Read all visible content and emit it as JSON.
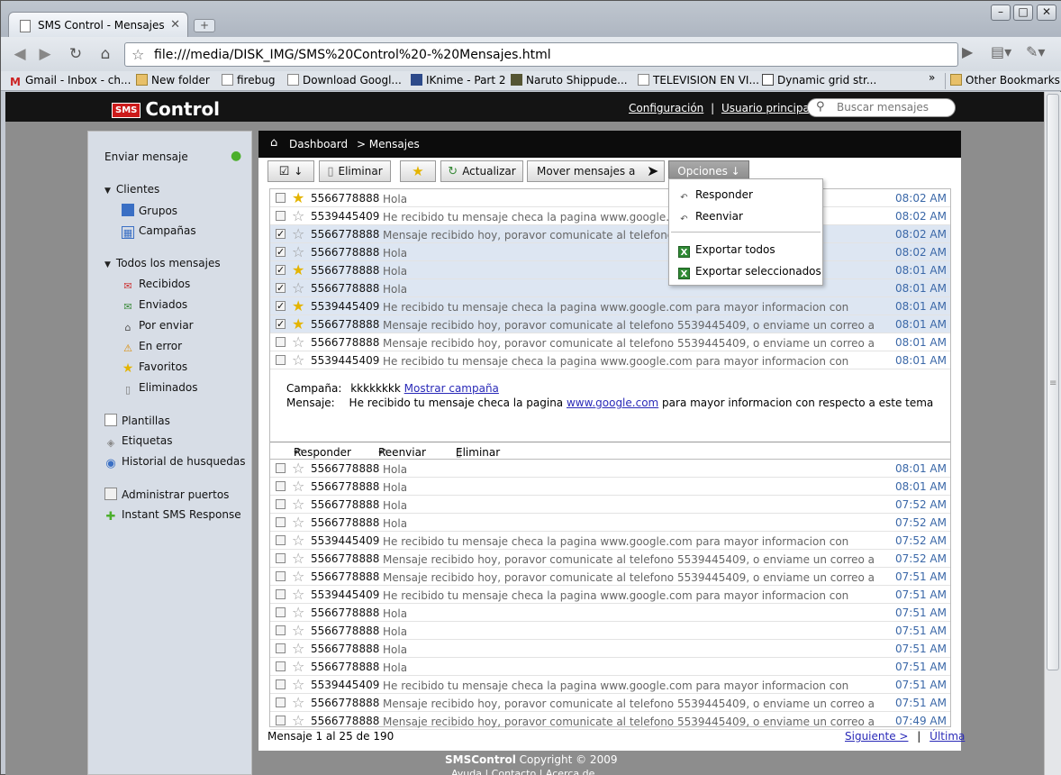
{
  "browser": {
    "tab_title": "SMS Control - Mensajes",
    "url": "file:///media/DISK_IMG/SMS%20Control%20-%20Mensajes.html",
    "bookmarks": [
      {
        "label": "Gmail - Inbox - ch...",
        "icon": "gmail-icon"
      },
      {
        "label": "New folder",
        "icon": "folder-icon"
      },
      {
        "label": "firebug",
        "icon": "page-icon"
      },
      {
        "label": "Download Googl...",
        "icon": "page-icon"
      },
      {
        "label": "IKnime - Part 2",
        "icon": "knime-icon"
      },
      {
        "label": "Naruto Shippude...",
        "icon": "site-icon"
      },
      {
        "label": "TELEVISION EN VI...",
        "icon": "page-icon"
      },
      {
        "label": "Dynamic grid str...",
        "icon": "dojo-icon"
      }
    ],
    "other_bookmarks": "Other Bookmarks"
  },
  "app": {
    "logo_badge": "SMS",
    "logo_text": "Control",
    "config_link": "Configuración",
    "separator": "|",
    "user_link": "Usuario principal",
    "search_placeholder": "Buscar mensajes"
  },
  "sidebar": {
    "send": "Enviar mensaje",
    "clients": "Clientes",
    "groups": "Grupos",
    "campaigns": "Campañas",
    "all_messages": "Todos los mensajes",
    "received": "Recibidos",
    "sent": "Enviados",
    "to_send": "Por enviar",
    "error": "En error",
    "favorites": "Favoritos",
    "deleted": "Eliminados",
    "templates": "Plantillas",
    "tags": "Etiquetas",
    "history": "Historial de husquedas",
    "ports": "Administrar puertos",
    "instant": "Instant SMS Response"
  },
  "breadcrumb": {
    "home": "Dashboard",
    "current": "> Mensajes"
  },
  "toolbar": {
    "select": "↓",
    "delete": "Eliminar",
    "refresh": "Actualizar",
    "move": "Mover mensajes a",
    "options": "Opciones ↓"
  },
  "dropdown": {
    "reply": "Responder",
    "forward": "Reenviar",
    "export_all": "Exportar todos",
    "export_selected": "Exportar seleccionados"
  },
  "messages_top": [
    {
      "phone": "5566778888",
      "text": "Hola",
      "time": "08:02 AM",
      "checked": false,
      "starred": true
    },
    {
      "phone": "5539445409",
      "text": "He recibido tu mensaje checa la pagina www.google.com p",
      "time": "08:02 AM",
      "checked": false,
      "starred": false
    },
    {
      "phone": "5566778888",
      "text": "Mensaje recibido hoy, poravor comunicate al telefono 553",
      "text2": "a",
      "time": "08:02 AM",
      "checked": true,
      "starred": false
    },
    {
      "phone": "5566778888",
      "text": "Hola",
      "time": "08:02 AM",
      "checked": true,
      "starred": false
    },
    {
      "phone": "5566778888",
      "text": "Hola",
      "time": "08:01 AM",
      "checked": true,
      "starred": true
    },
    {
      "phone": "5566778888",
      "text": "Hola",
      "time": "08:01 AM",
      "checked": true,
      "starred": false
    },
    {
      "phone": "5539445409",
      "text": "He recibido tu mensaje checa la pagina www.google.com para mayor informacion con",
      "time": "08:01 AM",
      "checked": true,
      "starred": true
    },
    {
      "phone": "5566778888",
      "text": "Mensaje recibido hoy, poravor comunicate al telefono 5539445409, o enviame un correo a",
      "time": "08:01 AM",
      "checked": true,
      "starred": true
    },
    {
      "phone": "5566778888",
      "text": "Mensaje recibido hoy, poravor comunicate al telefono 5539445409, o enviame un correo a",
      "time": "08:01 AM",
      "checked": false,
      "starred": false
    },
    {
      "phone": "5539445409",
      "text": "He recibido tu mensaje checa la pagina www.google.com para mayor informacion con",
      "time": "08:01 AM",
      "checked": false,
      "starred": false
    }
  ],
  "detail": {
    "campaign_label": "Campaña:",
    "campaign_value": "kkkkkkkk",
    "show_campaign": "Mostrar campaña",
    "message_label": "Mensaje:",
    "message_pre": "He recibido tu mensaje checa la pagina",
    "message_link": "www.google.com",
    "message_post": "para mayor informacion con respecto a este tema",
    "reply": "Responder",
    "forward": "Reenviar",
    "delete": "Eliminar"
  },
  "messages_bottom": [
    {
      "phone": "5566778888",
      "text": "Hola",
      "time": "08:01 AM"
    },
    {
      "phone": "5566778888",
      "text": "Hola",
      "time": "08:01 AM"
    },
    {
      "phone": "5566778888",
      "text": "Hola",
      "time": "07:52 AM"
    },
    {
      "phone": "5566778888",
      "text": "Hola",
      "time": "07:52 AM"
    },
    {
      "phone": "5539445409",
      "text": "He recibido tu mensaje checa la pagina www.google.com para mayor informacion con",
      "time": "07:52 AM"
    },
    {
      "phone": "5566778888",
      "text": "Mensaje recibido hoy, poravor comunicate al telefono 5539445409, o enviame un correo a",
      "time": "07:52 AM"
    },
    {
      "phone": "5566778888",
      "text": "Mensaje recibido hoy, poravor comunicate al telefono 5539445409, o enviame un correo a",
      "time": "07:51 AM"
    },
    {
      "phone": "5539445409",
      "text": "He recibido tu mensaje checa la pagina www.google.com para mayor informacion con",
      "time": "07:51 AM"
    },
    {
      "phone": "5566778888",
      "text": "Hola",
      "time": "07:51 AM"
    },
    {
      "phone": "5566778888",
      "text": "Hola",
      "time": "07:51 AM"
    },
    {
      "phone": "5566778888",
      "text": "Hola",
      "time": "07:51 AM"
    },
    {
      "phone": "5566778888",
      "text": "Hola",
      "time": "07:51 AM"
    },
    {
      "phone": "5539445409",
      "text": "He recibido tu mensaje checa la pagina www.google.com para mayor informacion con",
      "time": "07:51 AM"
    },
    {
      "phone": "5566778888",
      "text": "Mensaje recibido hoy, poravor comunicate al telefono 5539445409, o enviame un correo a",
      "time": "07:51 AM"
    },
    {
      "phone": "5566778888",
      "text": "Mensaje recibido hoy, poravor comunicate al telefono 5539445409, o enviame un correo a",
      "time": "07:49 AM"
    }
  ],
  "footer": {
    "count": "Mensaje 1 al 25 de 190",
    "next": "Siguiente >",
    "sep": "|",
    "last": "Última",
    "copyright_brand": "SMSControl",
    "copyright": "Copyright © 2009",
    "bottom_links": "Ayuda | Contacto | Acerca de"
  },
  "colors": {
    "accent": "#3b68a8",
    "selected_row": "#dde6f2",
    "header": "#141414",
    "star": "#e4b400",
    "excel": "#2f8a34"
  }
}
